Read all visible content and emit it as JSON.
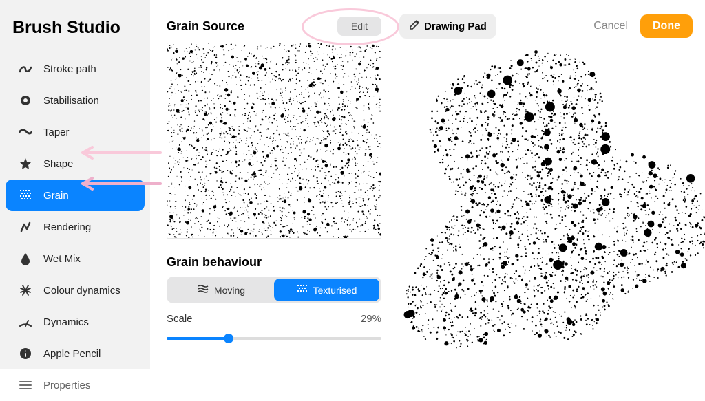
{
  "app": {
    "title": "Brush Studio"
  },
  "sidebar": {
    "items": [
      {
        "label": "Stroke path"
      },
      {
        "label": "Stabilisation"
      },
      {
        "label": "Taper"
      },
      {
        "label": "Shape"
      },
      {
        "label": "Grain"
      },
      {
        "label": "Rendering"
      },
      {
        "label": "Wet Mix"
      },
      {
        "label": "Colour dynamics"
      },
      {
        "label": "Dynamics"
      },
      {
        "label": "Apple Pencil"
      },
      {
        "label": "Properties"
      }
    ],
    "active_index": 4
  },
  "grain_source": {
    "title": "Grain Source",
    "edit_label": "Edit"
  },
  "grain_behaviour": {
    "title": "Grain behaviour",
    "options": [
      {
        "label": "Moving"
      },
      {
        "label": "Texturised"
      }
    ],
    "active_index": 1,
    "scale_label": "Scale",
    "scale_value": "29%",
    "scale_percent": 29
  },
  "drawing_pad": {
    "label": "Drawing Pad"
  },
  "actions": {
    "cancel": "Cancel",
    "done": "Done"
  }
}
